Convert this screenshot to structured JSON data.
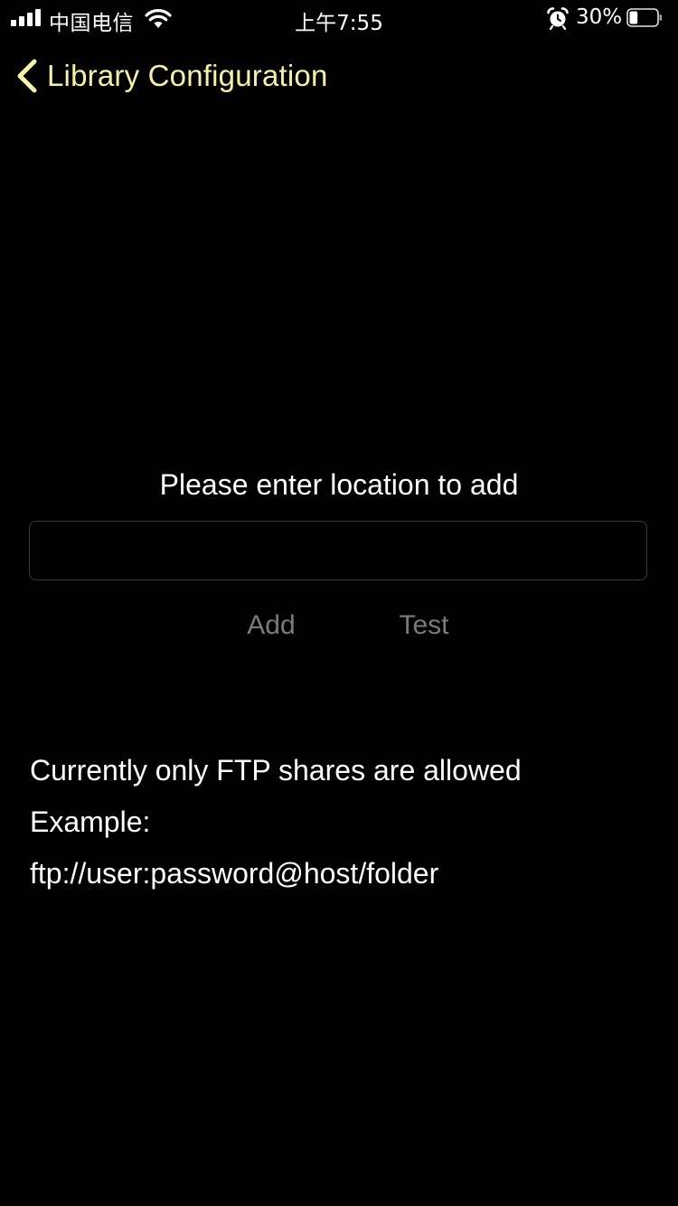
{
  "status_bar": {
    "carrier": "中国电信",
    "time": "上午7:55",
    "battery_percent": "30%",
    "battery_level": 0.3,
    "icons": [
      "signal-icon",
      "wifi-icon",
      "alarm-icon",
      "battery-icon"
    ]
  },
  "nav": {
    "back_label": "Library Configuration",
    "back_icon": "chevron-left-icon",
    "accent_color": "#f5f3a0"
  },
  "main": {
    "prompt": "Please enter location to add",
    "location_input": {
      "value": "",
      "placeholder": ""
    },
    "add_label": "Add",
    "test_label": "Test",
    "info_lines": [
      "Currently only FTP shares are allowed",
      "Example:",
      "ftp://user:password@host/folder"
    ]
  },
  "colors": {
    "background": "#000000",
    "text": "#ffffff",
    "disabled_button": "#7a7a7a",
    "input_border": "#3a3a3c"
  }
}
